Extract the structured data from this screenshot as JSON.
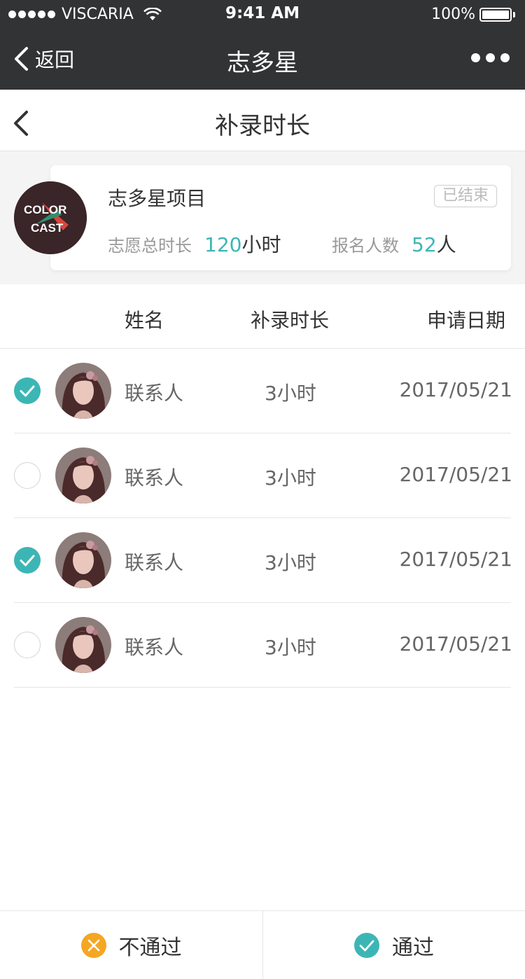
{
  "status_bar": {
    "carrier": "VISCARIA",
    "time": "9:41 AM",
    "battery": "100%"
  },
  "nav": {
    "back_label": "返回",
    "title": "志多星"
  },
  "page": {
    "title": "补录时长"
  },
  "project": {
    "name": "志多星项目",
    "status_badge": "已结束",
    "total_hours_label": "志愿总时长",
    "total_hours_value": "120",
    "total_hours_unit": "小时",
    "signup_label": "报名人数",
    "signup_value": "52",
    "signup_unit": "人",
    "logo_text_top": "COLOR",
    "logo_text_bottom": "CAST"
  },
  "table": {
    "headers": {
      "name": "姓名",
      "duration": "补录时长",
      "date": "申请日期"
    },
    "rows": [
      {
        "checked": true,
        "name": "联系人",
        "duration": "3小时",
        "date": "2017/05/21"
      },
      {
        "checked": false,
        "name": "联系人",
        "duration": "3小时",
        "date": "2017/05/21"
      },
      {
        "checked": true,
        "name": "联系人",
        "duration": "3小时",
        "date": "2017/05/21"
      },
      {
        "checked": false,
        "name": "联系人",
        "duration": "3小时",
        "date": "2017/05/21"
      }
    ]
  },
  "actions": {
    "reject_label": "不通过",
    "approve_label": "通过"
  },
  "colors": {
    "accent": "#3cb6b5",
    "reject": "#f5a623",
    "nav_bg": "#323335"
  }
}
